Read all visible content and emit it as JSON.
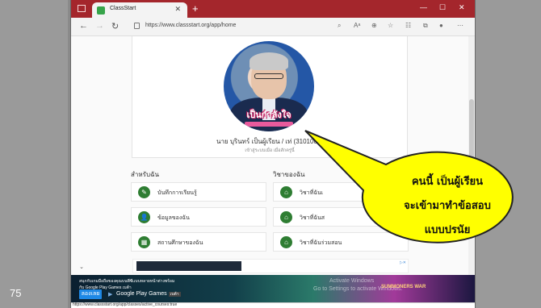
{
  "slide_number": "75",
  "browser": {
    "tab_title": "ClassStart",
    "url": "https://www.classstart.org/app/home"
  },
  "profile": {
    "avatar_banner": "เป็นกำลังใจ",
    "name": "นาย บุรินทร์ เป็นผู้เรียน / เท่ (3101001)",
    "subtitle": "เข้าสู่ระบบเมื่อ เมื่อสักครู่นี้"
  },
  "sections": {
    "left_title": "สำหรับฉัน",
    "right_title": "วิชาของฉัน",
    "left_items": [
      {
        "label": "บันทึกการเรียนรู้",
        "icon": "notebook-icon"
      },
      {
        "label": "ข้อมูลของฉัน",
        "icon": "user-icon"
      },
      {
        "label": "สถานศึกษาของฉัน",
        "icon": "school-icon"
      }
    ],
    "right_items": [
      {
        "label": "วิชาที่ฉันเ",
        "icon": "home-icon"
      },
      {
        "label": "วิชาที่ฉันส",
        "icon": "home-icon"
      },
      {
        "label": "วิชาที่ฉันร่วมสอน",
        "icon": "home-icon"
      }
    ]
  },
  "banner": {
    "text_line1": "สนุกกับเกมมือถือของคุณบนพีซีแบบหลายหน้าต่างพร้อม",
    "text_line2": "กับ Google Play Games เบต้า",
    "button_label": "ลองเลย",
    "gplay_label": "Google Play Games",
    "gplay_badge": "เบต้า",
    "watermark_line1": "Activate Windows",
    "watermark_line2": "Go to Settings to activate Windows.",
    "game_logo": "SUMMONERS WAR"
  },
  "status_url": "https://www.classstart.org/app/classes/active_courses:true",
  "callout": {
    "line1": "คนนี้ เป็นผู้เรียน",
    "line2": "จะเข้ามาทำข้อสอบ",
    "line3": "แบบปรนัย",
    "fill_color": "#ffff00"
  }
}
